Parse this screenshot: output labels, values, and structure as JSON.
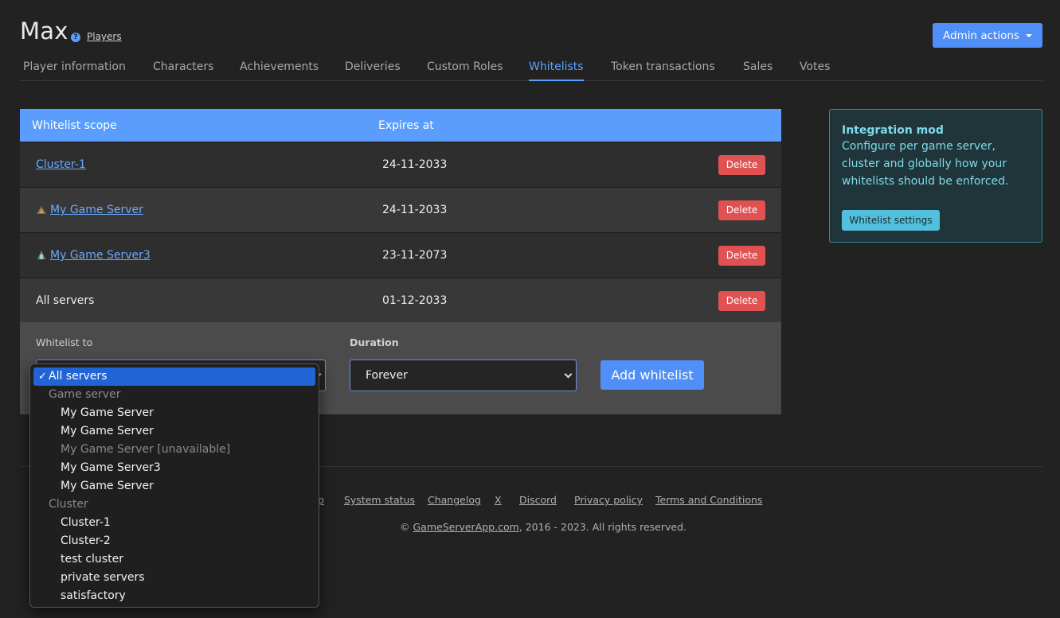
{
  "header": {
    "player_name": "Max",
    "players_link": "Players",
    "admin_button": "Admin actions"
  },
  "tabs": [
    {
      "label": "Player information",
      "active": false
    },
    {
      "label": "Characters",
      "active": false
    },
    {
      "label": "Achievements",
      "active": false
    },
    {
      "label": "Deliveries",
      "active": false
    },
    {
      "label": "Custom Roles",
      "active": false
    },
    {
      "label": "Whitelists",
      "active": true
    },
    {
      "label": "Token transactions",
      "active": false
    },
    {
      "label": "Sales",
      "active": false
    },
    {
      "label": "Votes",
      "active": false
    }
  ],
  "table": {
    "col_scope": "Whitelist scope",
    "col_expires": "Expires at",
    "delete_label": "Delete",
    "rows": [
      {
        "scope": "Cluster-1",
        "expires": "24-11-2033",
        "link": true,
        "icon": ""
      },
      {
        "scope": "My Game Server",
        "expires": "24-11-2033",
        "link": true,
        "icon": "game-server-icon"
      },
      {
        "scope": "My Game Server3",
        "expires": "23-11-2073",
        "link": true,
        "icon": "game-server-icon"
      },
      {
        "scope": "All servers",
        "expires": "01-12-2033",
        "link": false,
        "icon": ""
      }
    ]
  },
  "form": {
    "whitelist_to_label": "Whitelist to",
    "duration_label": "Duration",
    "duration_value": "Forever",
    "add_button": "Add whitelist"
  },
  "dropdown": {
    "selected": "All servers",
    "groups": [
      {
        "label": "Game server",
        "options": [
          {
            "label": "My Game Server",
            "disabled": false
          },
          {
            "label": "My Game Server",
            "disabled": false
          },
          {
            "label": "My Game Server [unavailable]",
            "disabled": true
          },
          {
            "label": "My Game Server3",
            "disabled": false
          },
          {
            "label": "My Game Server",
            "disabled": false
          }
        ]
      },
      {
        "label": "Cluster",
        "options": [
          {
            "label": "Cluster-1",
            "disabled": false
          },
          {
            "label": "Cluster-2",
            "disabled": false
          },
          {
            "label": "test cluster",
            "disabled": false
          },
          {
            "label": "private servers",
            "disabled": false
          },
          {
            "label": "satisfactory",
            "disabled": false
          }
        ]
      }
    ]
  },
  "integration": {
    "title": "Integration mod",
    "text": "Configure per game server, cluster and globally how your whitelists should be enforced.",
    "button": "Whitelist settings"
  },
  "footer": {
    "links": [
      "p",
      "System status",
      "Changelog",
      "X",
      "Discord",
      "Privacy policy",
      "Terms and Conditions"
    ],
    "copyright_prefix": "© ",
    "copyright_site": "GameServerApp.com",
    "copyright_suffix": ", 2016 - 2023. All rights reserved."
  },
  "colors": {
    "accent": "#4f8ff7",
    "danger": "#e05252",
    "info": "#52c0dd"
  }
}
